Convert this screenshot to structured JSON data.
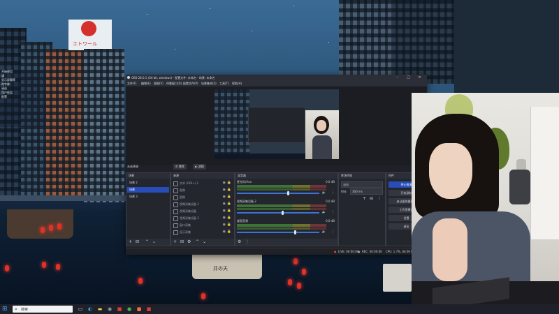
{
  "desktop": {
    "sign_text": "エトワール",
    "boat_text": "井の天",
    "widget_lines": [
      "开始使用",
      "请",
      "显示屏幕等",
      "的字体",
      "请选",
      "用户在运",
      "配置"
    ]
  },
  "obs": {
    "window_title": "OBS 28.0.1 (64-bit, windows) - 配置文件: 未命名 - 场景: 未命名",
    "menu": [
      "文件(F)",
      "编辑(E)",
      "视图(V)",
      "停靠窗口(D)",
      "配置文件(P)",
      "场景集合(S)",
      "工具(T)",
      "帮助(H)"
    ],
    "scene_label": "未选择源",
    "toolbar": {
      "properties": "属性",
      "filters": "滤镜"
    },
    "docks": {
      "scenes": {
        "title": "场景",
        "items": [
          "场景 2",
          "场景",
          "场景 3"
        ],
        "selected_index": 1
      },
      "sources": {
        "title": "来源",
        "items": [
          "文本 (GDI+) 2",
          "图像",
          "图像",
          "视频采集设备 2",
          "视频采集设备",
          "视频采集设备 3",
          "窗口采集",
          "显示采集"
        ]
      },
      "mixer": {
        "title": "混音器",
        "channels": [
          {
            "name": "麦克风/Aux",
            "db": "0.0 dB",
            "level": 0.62
          },
          {
            "name": "视频采集设备 2",
            "db": "0.0 dB",
            "level": 0.55
          },
          {
            "name": "桌面音频",
            "db": "0.0 dB",
            "level": 0.7
          }
        ]
      },
      "transitions": {
        "title": "转场特效",
        "type": "淡出",
        "duration_label": "时长",
        "duration": "300 ms"
      },
      "controls": {
        "title": "控件",
        "buttons": [
          "停止推流",
          "开始录制",
          "启动虚拟摄像机",
          "工作室模式",
          "设置",
          "退出"
        ]
      }
    },
    "status": {
      "live": "LIVE: 00:00:00",
      "rec": "REC: 00:00:00",
      "cpu": "CPU: 1.7%, 60.00 fps"
    }
  },
  "taskbar": {
    "search_placeholder": "搜索",
    "apps": [
      "task-view-icon",
      "edge-icon",
      "explorer-icon",
      "store-icon",
      "chrome-icon",
      "obs-icon",
      "app-icon",
      "app-icon",
      "app-icon",
      "app-icon"
    ]
  },
  "colors": {
    "accent": "#284cb8",
    "obs_bg": "#1f2127",
    "lantern": "#e2302a"
  }
}
